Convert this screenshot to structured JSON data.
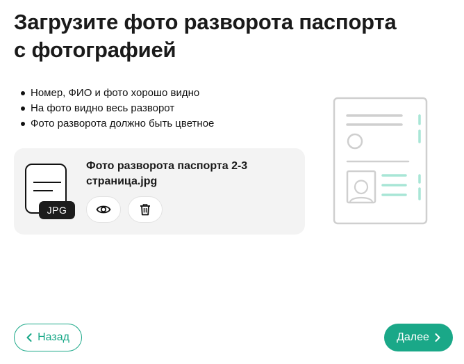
{
  "header": {
    "title_line1": "Загрузите фото разворота паспорта",
    "title_line2": "с фотографией"
  },
  "requirements": [
    "Номер, ФИО и фото хорошо видно",
    "На фото видно весь разворот",
    "Фото разворота должно быть цветное"
  ],
  "file": {
    "type_badge": "JPG",
    "name_line1": "Фото разворота паспорта 2-3",
    "name_line2": "страница.jpg",
    "view_icon": "eye-icon",
    "delete_icon": "trash-icon"
  },
  "navigation": {
    "back_label": "Назад",
    "next_label": "Далее"
  },
  "colors": {
    "accent": "#1aa888",
    "card_bg": "#f3f3f3",
    "illustration_gray": "#cfcfcf",
    "illustration_mint": "#a8e6d6"
  }
}
